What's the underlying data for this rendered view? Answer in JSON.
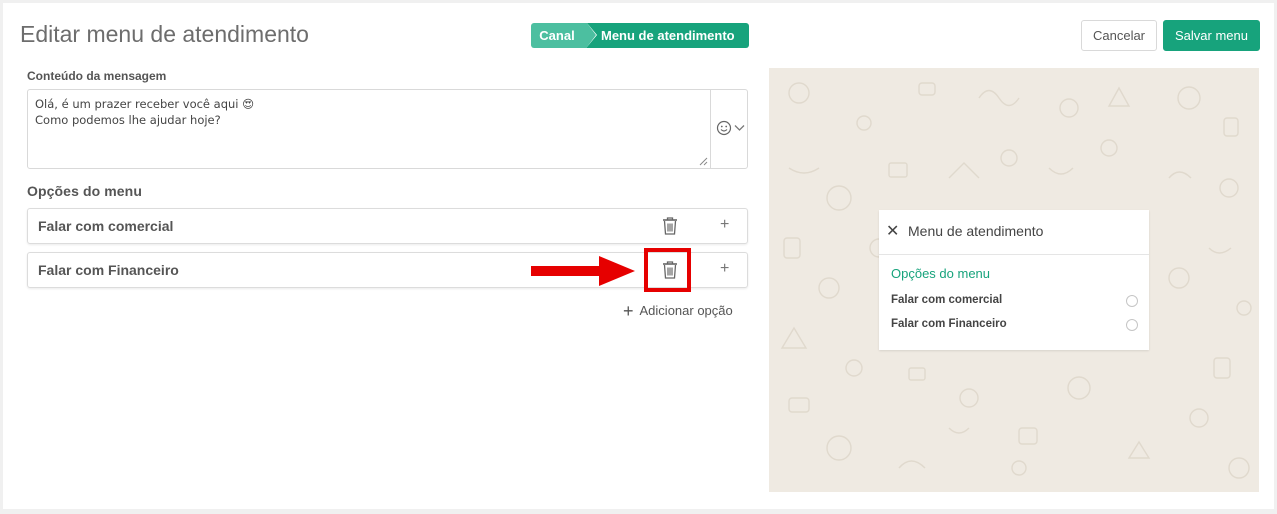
{
  "header": {
    "title": "Editar menu de atendimento",
    "steps": [
      "Canal",
      "Menu de atendimento"
    ],
    "cancel_label": "Cancelar",
    "save_label": "Salvar menu"
  },
  "message": {
    "label": "Conteúdo da mensagem",
    "text": "Olá, é um prazer receber você aqui 😍\nComo podemos lhe ajudar hoje?",
    "emoji_icon": "smiley-icon"
  },
  "options": {
    "title": "Opções do menu",
    "items": [
      {
        "label": "Falar com comercial"
      },
      {
        "label": "Falar com Financeiro"
      }
    ],
    "add_label": "Adicionar opção"
  },
  "preview": {
    "close_symbol": "✕",
    "title": "Menu de atendimento",
    "section": "Opções do menu",
    "items": [
      "Falar com comercial",
      "Falar com Financeiro"
    ]
  },
  "colors": {
    "accent": "#17a37c",
    "accent_light": "#4cbfa0",
    "highlight": "#e60000",
    "preview_bg": "#efeae2"
  }
}
